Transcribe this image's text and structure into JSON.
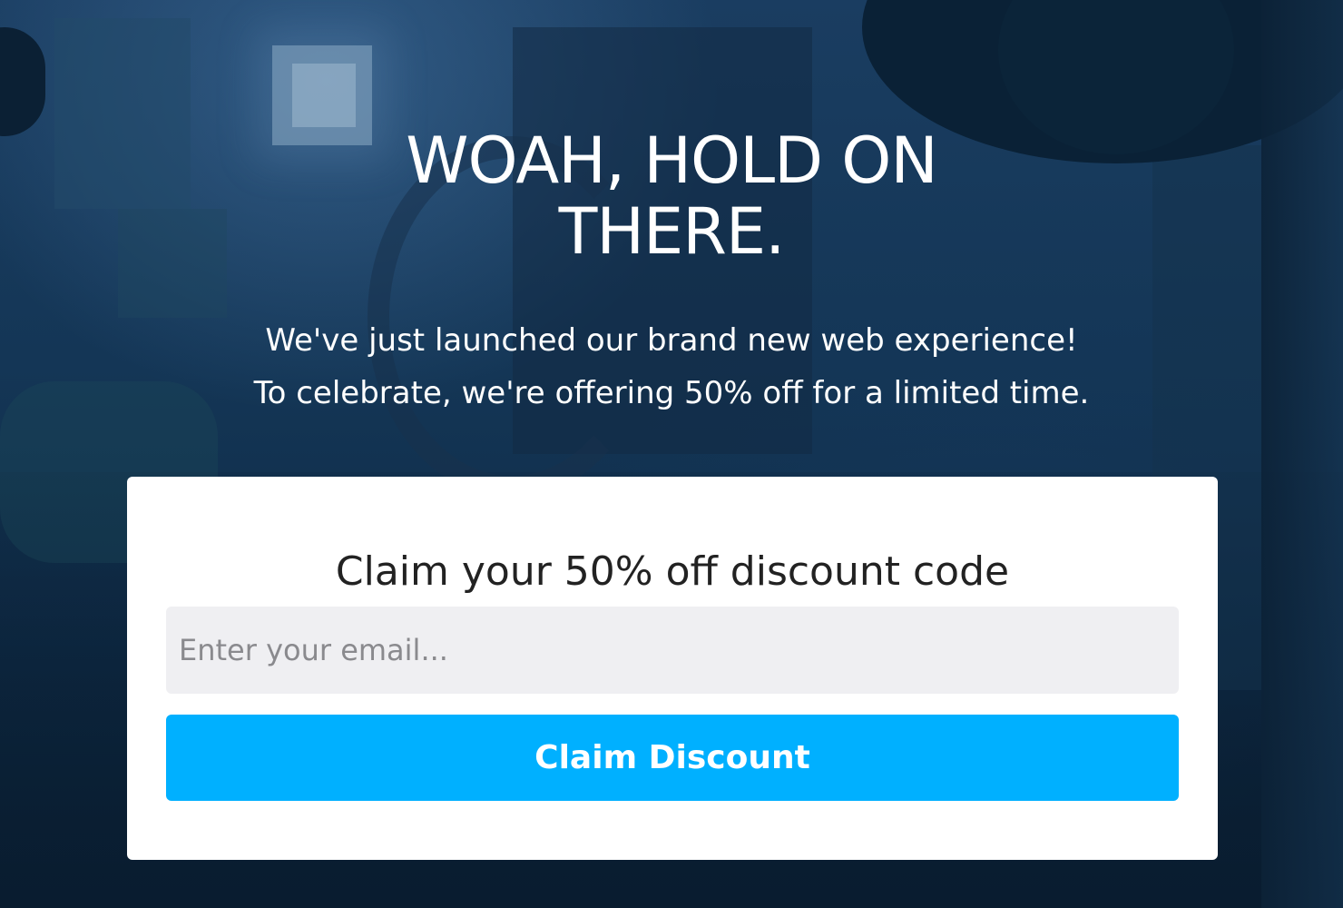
{
  "hero": {
    "headline_line1": "WOAH, HOLD ON",
    "headline_line2": "THERE.",
    "subtext_line1": "We've just launched our brand new web experience!",
    "subtext_line2": "To celebrate, we're offering 50% off for a limited time."
  },
  "form": {
    "title": "Claim your 50% off discount code",
    "email_value": "",
    "email_placeholder": "Enter your email...",
    "button_label": "Claim Discount"
  },
  "colors": {
    "background": "#143656",
    "card": "#ffffff",
    "input_bg": "#efeff2",
    "button": "#00b0ff",
    "button_text": "#ffffff"
  }
}
